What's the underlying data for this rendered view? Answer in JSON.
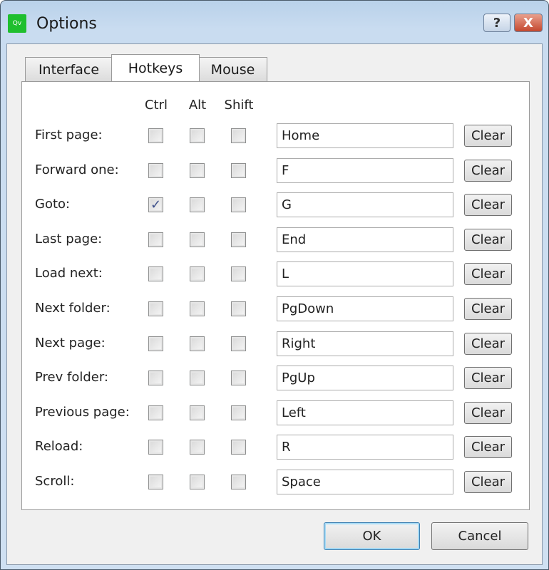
{
  "window": {
    "title": "Options",
    "app_icon_text": "Qv",
    "help_label": "?",
    "close_label": "X"
  },
  "tabs": [
    {
      "label": "Interface",
      "active": false
    },
    {
      "label": "Hotkeys",
      "active": true
    },
    {
      "label": "Mouse",
      "active": false
    }
  ],
  "columns": {
    "ctrl": "Ctrl",
    "alt": "Alt",
    "shift": "Shift"
  },
  "clear_label": "Clear",
  "hotkeys": [
    {
      "label": "First page:",
      "ctrl": false,
      "alt": false,
      "shift": false,
      "key": "Home"
    },
    {
      "label": "Forward one:",
      "ctrl": false,
      "alt": false,
      "shift": false,
      "key": "F"
    },
    {
      "label": "Goto:",
      "ctrl": true,
      "alt": false,
      "shift": false,
      "key": "G"
    },
    {
      "label": "Last page:",
      "ctrl": false,
      "alt": false,
      "shift": false,
      "key": "End"
    },
    {
      "label": "Load next:",
      "ctrl": false,
      "alt": false,
      "shift": false,
      "key": "L"
    },
    {
      "label": "Next folder:",
      "ctrl": false,
      "alt": false,
      "shift": false,
      "key": "PgDown"
    },
    {
      "label": "Next page:",
      "ctrl": false,
      "alt": false,
      "shift": false,
      "key": "Right"
    },
    {
      "label": "Prev folder:",
      "ctrl": false,
      "alt": false,
      "shift": false,
      "key": "PgUp"
    },
    {
      "label": "Previous page:",
      "ctrl": false,
      "alt": false,
      "shift": false,
      "key": "Left"
    },
    {
      "label": "Reload:",
      "ctrl": false,
      "alt": false,
      "shift": false,
      "key": "R"
    },
    {
      "label": "Scroll:",
      "ctrl": false,
      "alt": false,
      "shift": false,
      "key": "Space"
    }
  ],
  "buttons": {
    "ok": "OK",
    "cancel": "Cancel"
  }
}
